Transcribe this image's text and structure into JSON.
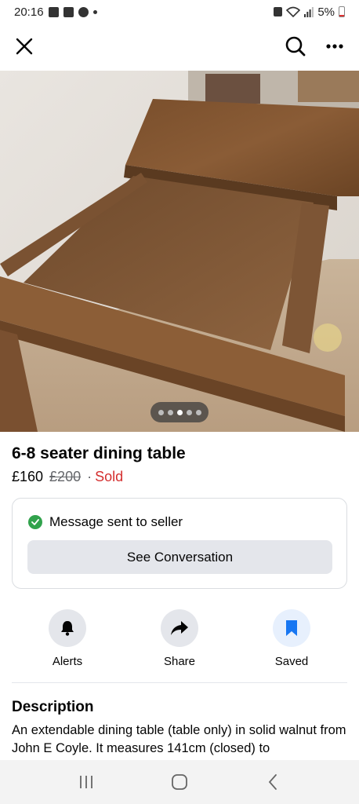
{
  "status_bar": {
    "time": "20:16",
    "battery": "5%"
  },
  "listing": {
    "title": "6-8 seater dining table",
    "price": "£160",
    "old_price": "£200",
    "separator": "·",
    "status": "Sold",
    "photo_count": 5,
    "active_photo_index": 3
  },
  "message_card": {
    "status_text": "Message sent to seller",
    "button_label": "See Conversation"
  },
  "actions": [
    {
      "label": "Alerts",
      "icon": "bell-icon"
    },
    {
      "label": "Share",
      "icon": "share-arrow-icon"
    },
    {
      "label": "Saved",
      "icon": "bookmark-icon"
    }
  ],
  "description": {
    "heading": "Description",
    "text": "An extendable dining table (table only) in solid walnut from John E Coyle. It measures 141cm (closed) to"
  },
  "colors": {
    "sold": "#d42e2e",
    "success": "#31a24c",
    "saved_accent": "#1877f2"
  }
}
